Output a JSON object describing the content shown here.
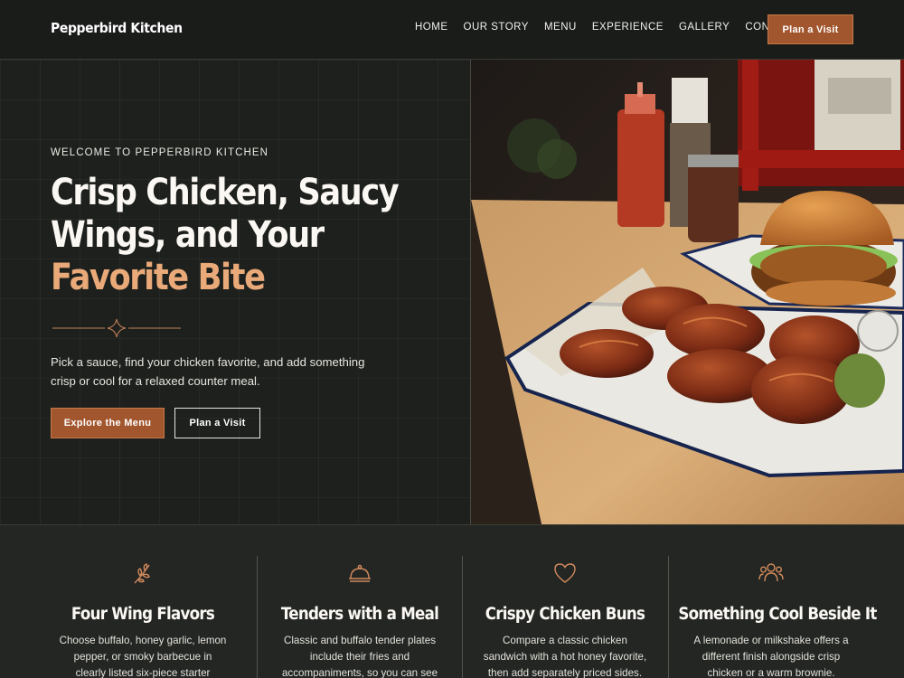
{
  "header": {
    "brand": "Pepperbird Kitchen",
    "nav": [
      "HOME",
      "OUR STORY",
      "MENU",
      "EXPERIENCE",
      "GALLERY",
      "CONTACT"
    ],
    "cta": "Plan a Visit"
  },
  "hero": {
    "eyebrow": "WELCOME TO PEPPERBIRD KITCHEN",
    "headline_line1": "Crisp Chicken, Saucy",
    "headline_line2": "Wings, and Your",
    "headline_accent": "Favorite Bite",
    "intro": "Pick a sauce, find your chicken favorite, and add something crisp or cool for a relaxed counter meal.",
    "primary_button": "Explore the Menu",
    "secondary_button": "Plan a Visit"
  },
  "features": [
    {
      "icon": "leaf-sprig-icon",
      "title": "Four Wing Flavors",
      "text": "Choose buffalo, honey garlic, lemon pepper, or smoky barbecue in clearly listed six-piece starter portions."
    },
    {
      "icon": "cloche-icon",
      "title": "Tenders with a Meal",
      "text": "Classic and buffalo tender plates include their fries and accompaniments, so you can see"
    },
    {
      "icon": "heart-icon",
      "title": "Crispy Chicken Buns",
      "text": "Compare a classic chicken sandwich with a hot honey favorite, then add separately priced sides."
    },
    {
      "icon": "people-icon",
      "title": "Something Cool Beside It",
      "text": "A lemonade or milkshake offers a different finish alongside crisp chicken or a warm brownie."
    }
  ],
  "colors": {
    "accent": "#a2562e",
    "accent_text": "#e9a978",
    "background": "#1d201d"
  }
}
